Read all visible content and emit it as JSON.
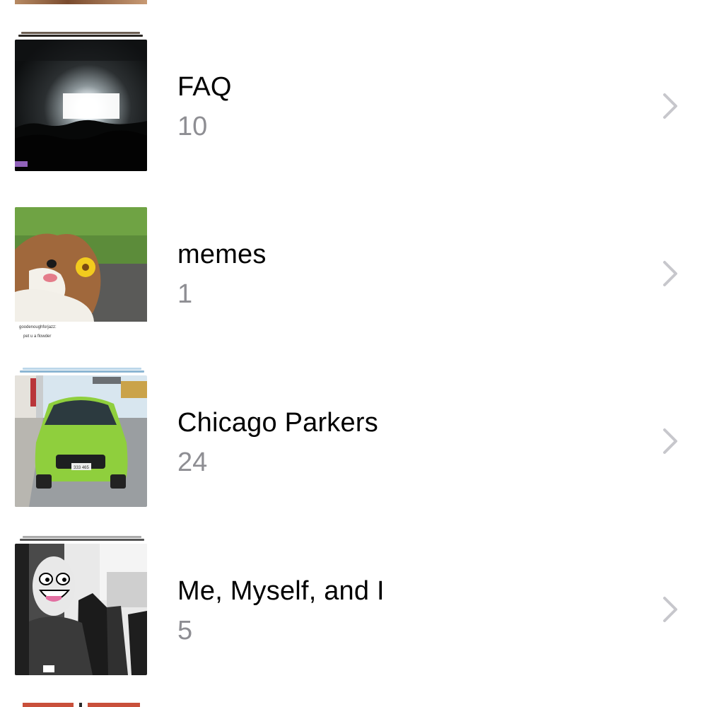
{
  "albums": [
    {
      "title": "FAQ",
      "count": "10",
      "thumbnail": "concert-stage-photo"
    },
    {
      "title": "memes",
      "count": "1",
      "thumbnail": "dog-with-sunflower-photo",
      "caption_top": "goodenoughforjazz:",
      "caption_bottom": "pet u a flowder"
    },
    {
      "title": "Chicago Parkers",
      "count": "24",
      "thumbnail": "green-car-photo",
      "plate": "333 465"
    },
    {
      "title": "Me, Myself, and I",
      "count": "5",
      "thumbnail": "awesome-face-selfie-photo"
    }
  ],
  "chevron_icon": "chevron-right-icon",
  "colors": {
    "title": "#000000",
    "count": "#8e8e93",
    "chevron": "#c7c7cc",
    "background": "#ffffff"
  }
}
